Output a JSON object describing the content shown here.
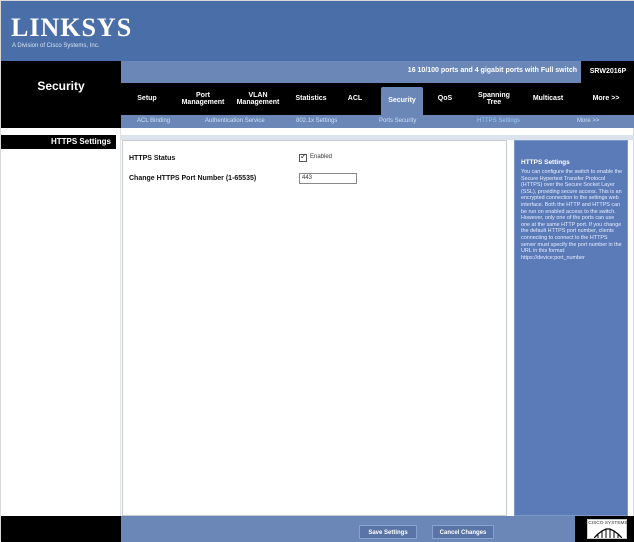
{
  "brand": {
    "logo": "LINKSYS",
    "tagline": "A Division of Cisco Systems, Inc."
  },
  "header": {
    "section_title": "Security",
    "banner": "16 10/100 ports and 4 gigabit ports with Full switch",
    "model": "SRW2016P"
  },
  "tabs": [
    {
      "label": "Setup"
    },
    {
      "label": "Port Management"
    },
    {
      "label": "VLAN Management"
    },
    {
      "label": "Statistics"
    },
    {
      "label": "ACL"
    },
    {
      "label": "Security"
    },
    {
      "label": "QoS"
    },
    {
      "label": "Spanning Tree"
    },
    {
      "label": "Multicast"
    },
    {
      "label": "More >>"
    }
  ],
  "subtabs": [
    {
      "label": "ACL Binding"
    },
    {
      "label": "Authentication Service"
    },
    {
      "label": "802.1x Settings"
    },
    {
      "label": "Ports Security"
    },
    {
      "label": "HTTPS Settings"
    },
    {
      "label": "More >>"
    }
  ],
  "page": {
    "label": "HTTPS Settings",
    "https_status_label": "HTTPS Status",
    "https_status_checkbox_label": "Enabled",
    "https_port_label": "Change HTTPS Port Number (1-65535)",
    "https_port_value": "443"
  },
  "help": {
    "title": "HTTPS Settings",
    "text": "You can configure the switch to enable the Secure Hypertext Transfer Protocol (HTTPS) over the Secure Socket Layer (SSL), providing secure access. This is an encrypted connection to the settings web interface. Both the HTTP and HTTPS can be run on enabled access to the switch. However, only one of the ports can use one at the same HTTP port. If you change the default HTTPS port number, clients connecting to connect to the HTTPS server must specify the port number in the URL in this format: https://device:port_number"
  },
  "footer": {
    "save_label": "Save Settings",
    "cancel_label": "Cancel Changes",
    "cisco_label": "CISCO SYSTEMS"
  },
  "colors": {
    "accent": "#6a87b8",
    "logo_bar": "#4a6fa8",
    "dark": "#000000",
    "help_bg": "#5a7ab8"
  }
}
